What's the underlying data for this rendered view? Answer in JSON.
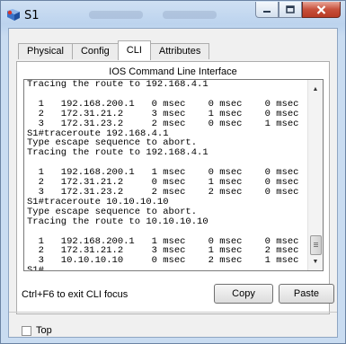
{
  "window": {
    "title": "S1",
    "accent_color": "#c7503b",
    "caption_icons": [
      "minimize-icon",
      "maximize-icon",
      "close-icon"
    ]
  },
  "tabs": [
    {
      "label": "Physical",
      "active": false
    },
    {
      "label": "Config",
      "active": false
    },
    {
      "label": "CLI",
      "active": true
    },
    {
      "label": "Attributes",
      "active": false
    }
  ],
  "cli": {
    "header": "IOS Command Line Interface",
    "terminal_lines": [
      "Tracing the route to 192.168.4.1",
      "",
      "  1   192.168.200.1   0 msec    0 msec    0 msec",
      "  2   172.31.21.2     3 msec    1 msec    0 msec",
      "  3   172.31.23.2     2 msec    0 msec    1 msec",
      "S1#traceroute 192.168.4.1",
      "Type escape sequence to abort.",
      "Tracing the route to 192.168.4.1",
      "",
      "  1   192.168.200.1   1 msec    0 msec    0 msec",
      "  2   172.31.21.2     0 msec    1 msec    0 msec",
      "  3   172.31.23.2     2 msec    2 msec    0 msec",
      "S1#traceroute 10.10.10.10",
      "Type escape sequence to abort.",
      "Tracing the route to 10.10.10.10",
      "",
      "  1   192.168.200.1   1 msec    0 msec    0 msec",
      "  2   172.31.21.2     3 msec    1 msec    2 msec",
      "  3   10.10.10.10     0 msec    2 msec    1 msec",
      "S1#"
    ]
  },
  "footer": {
    "focus_hint": "Ctrl+F6 to exit CLI focus",
    "copy_label": "Copy",
    "paste_label": "Paste"
  },
  "options": {
    "top_label": "Top",
    "top_checked": false
  }
}
